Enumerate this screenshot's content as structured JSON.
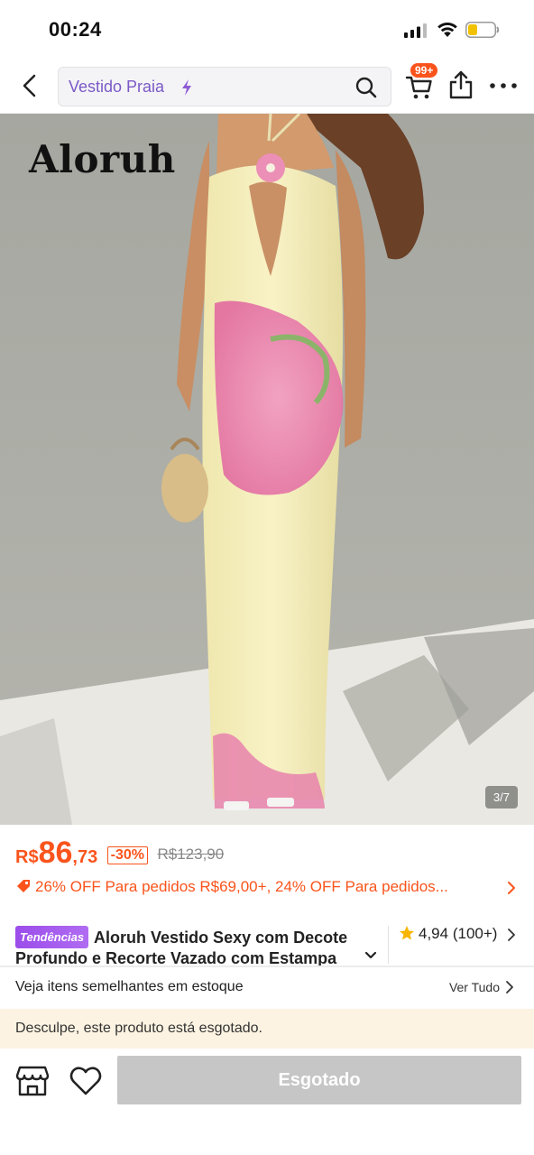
{
  "status_bar": {
    "time": "00:24",
    "signal_icon": "cellular-signal-icon",
    "wifi_icon": "wifi-icon",
    "battery_icon": "battery-low-icon",
    "battery_color": "#f2c200"
  },
  "header": {
    "back_icon": "chevron-left-icon",
    "search": {
      "value": "Vestido Praia",
      "icon": "search-icon",
      "trend_icon": "lightning-icon"
    },
    "cart": {
      "icon": "cart-icon",
      "badge": "99+"
    },
    "share_icon": "share-icon",
    "more_icon": "more-icon"
  },
  "gallery": {
    "brand": "Aloruh",
    "counter": "3/7"
  },
  "price": {
    "currency": "R$",
    "integer": "86",
    "decimal": ",73",
    "discount": "-30%",
    "original": "R$123,90",
    "color": "#fa541c"
  },
  "promotion": {
    "text": "26% OFF Para pedidos R$69,00+,  24% OFF Para pedidos..."
  },
  "product": {
    "badge": "Tendências",
    "title": "Aloruh Vestido Sexy com Decote Profundo e Recorte Vazado com Estampa",
    "rating": "4,94",
    "reviews": "(100+)"
  },
  "similar": {
    "label": "Veja itens semelhantes em estoque",
    "view_all": "Ver Tudo"
  },
  "notice": {
    "text": "Desculpe, este produto está esgotado."
  },
  "actions": {
    "button": "Esgotado",
    "store_icon": "store-icon",
    "wishlist_icon": "heart-icon"
  }
}
